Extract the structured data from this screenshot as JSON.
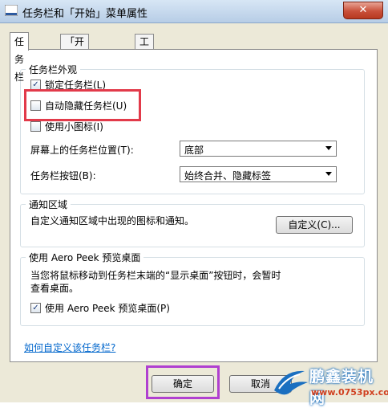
{
  "window": {
    "title": "任务栏和「开始」菜单属性",
    "close_glyph": "✕"
  },
  "tabs": [
    {
      "label": "任务栏"
    },
    {
      "label": "「开始」菜单"
    },
    {
      "label": "工具栏"
    }
  ],
  "appearance": {
    "title": "任务栏外观",
    "lock": {
      "label": "锁定任务栏(L)",
      "checked_glyph": "✓"
    },
    "autohide": {
      "label": "自动隐藏任务栏(U)"
    },
    "small_icons": {
      "label": "使用小图标(I)"
    },
    "position": {
      "label": "屏幕上的任务栏位置(T):",
      "value": "底部"
    },
    "buttons": {
      "label": "任务栏按钮(B):",
      "value": "始终合并、隐藏标签"
    }
  },
  "notification": {
    "title": "通知区域",
    "desc": "自定义通知区域中出现的图标和通知。",
    "customize_label": "自定义(C)..."
  },
  "peek": {
    "title": "使用 Aero Peek 预览桌面",
    "desc_line1": "当您将鼠标移动到任务栏末端的“显示桌面”按钮时，会暂时",
    "desc_line2": "查看桌面。",
    "checkbox": {
      "label": "使用 Aero Peek 预览桌面(P)",
      "checked_glyph": "✓"
    }
  },
  "help_link": "如何自定义该任务栏?",
  "footer": {
    "ok_label": "确定",
    "cancel_label": "取消"
  },
  "watermark": {
    "name": "鹏鑫装机网",
    "url": "www.0753px.com"
  },
  "colors": {
    "highlight_red": "#e23a4a",
    "highlight_purple": "#b040d0",
    "link": "#0066cc"
  }
}
